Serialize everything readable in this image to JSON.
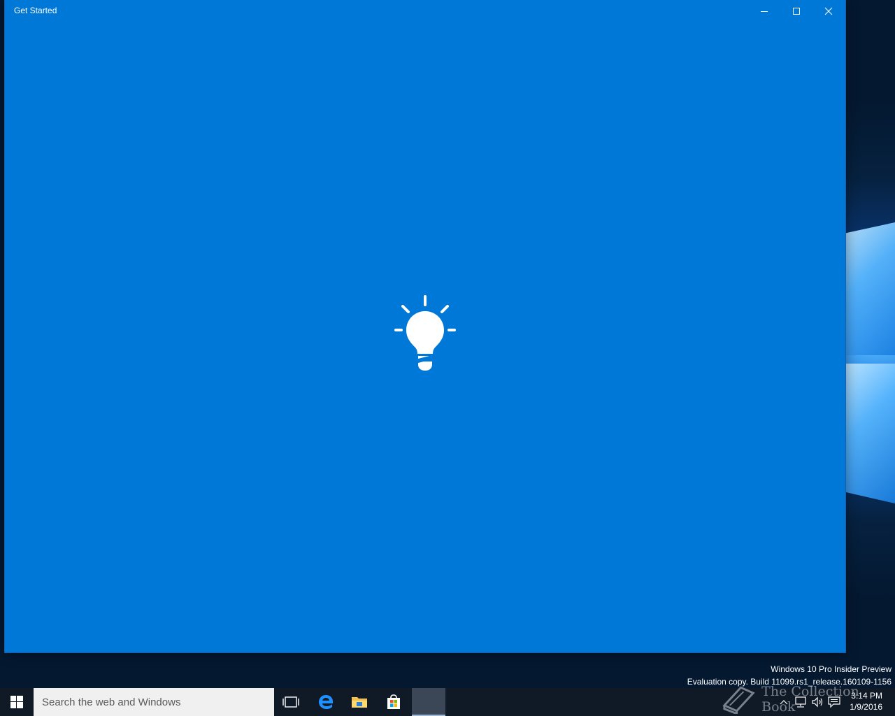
{
  "window": {
    "title": "Get Started",
    "background": "#0078d7",
    "controls": {
      "minimize": "minimize-icon",
      "maximize": "maximize-icon",
      "close": "close-icon"
    },
    "content_icon": "lightbulb-icon"
  },
  "watermark": {
    "line1": "Windows 10 Pro Insider Preview",
    "line2": "Evaluation copy. Build 11099.rs1_release.160109-1156"
  },
  "taskbar": {
    "search_placeholder": "Search the web and Windows",
    "apps": [
      "task-view-icon",
      "edge-icon",
      "file-explorer-icon",
      "store-icon",
      "get-started-app"
    ],
    "tray": [
      "chevron-up-icon",
      "network-icon",
      "volume-icon",
      "action-center-icon"
    ],
    "clock_time": "3:14 PM",
    "clock_date": "1/9/2016",
    "brand_text": "The Collection Book",
    "background": "#101a27"
  }
}
